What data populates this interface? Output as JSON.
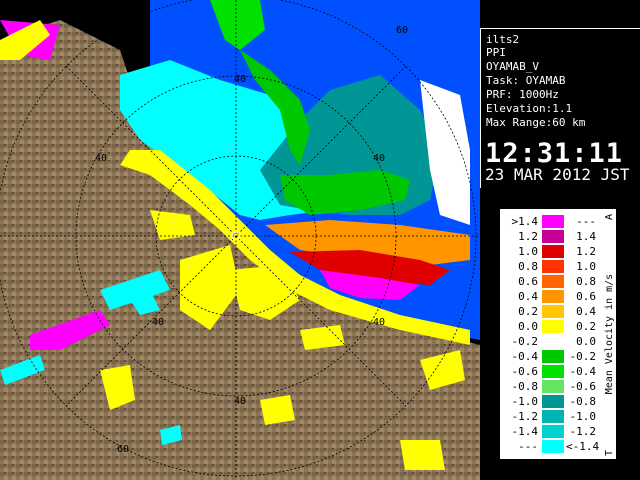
{
  "info": {
    "system": "ilts2",
    "product": "PPI",
    "site_var": "OYAMAB_V",
    "task": "Task: OYAMAB",
    "prf": "PRF: 1000Hz",
    "elevation": "Elevation:1.1",
    "max_range": "Max Range:60 km",
    "time": "12:31:11",
    "date": "23 MAR 2012 JST"
  },
  "range_ring_labels": [
    "60",
    "40",
    "60",
    "40",
    "40",
    "40",
    "40",
    "40",
    "60"
  ],
  "legend": {
    "title": "Mean Velocity in m/s",
    "top_marker": "A",
    "bottom_marker": "T",
    "rows": [
      {
        "lo": ">1.4",
        "hi": "---",
        "color": "#ff00ff"
      },
      {
        "lo": "1.2",
        "hi": "1.4",
        "color": "#c80096"
      },
      {
        "lo": "1.0",
        "hi": "1.2",
        "color": "#e10000"
      },
      {
        "lo": "0.8",
        "hi": "1.0",
        "color": "#ff3200"
      },
      {
        "lo": "0.6",
        "hi": "0.8",
        "color": "#ff6400"
      },
      {
        "lo": "0.4",
        "hi": "0.6",
        "color": "#ff9600"
      },
      {
        "lo": "0.2",
        "hi": "0.4",
        "color": "#ffc800"
      },
      {
        "lo": "0.0",
        "hi": "0.2",
        "color": "#ffff00"
      },
      {
        "lo": "-0.2",
        "hi": "0.0",
        "color": "#ffffff"
      },
      {
        "lo": "-0.4",
        "hi": "-0.2",
        "color": "#00c800"
      },
      {
        "lo": "-0.6",
        "hi": "-0.4",
        "color": "#00e100"
      },
      {
        "lo": "-0.8",
        "hi": "-0.6",
        "color": "#64e664"
      },
      {
        "lo": "-1.0",
        "hi": "-0.8",
        "color": "#009696"
      },
      {
        "lo": "-1.2",
        "hi": "-1.0",
        "color": "#00b4b4"
      },
      {
        "lo": "-1.4",
        "hi": "-1.2",
        "color": "#00d2d2"
      },
      {
        "lo": "---",
        "hi": "<-1.4",
        "color": "#00ffff"
      }
    ]
  },
  "colors": {
    "sea": "#0050ff",
    "land": "#8b7355",
    "coast": "#ffff00",
    "ring": "#000000"
  }
}
